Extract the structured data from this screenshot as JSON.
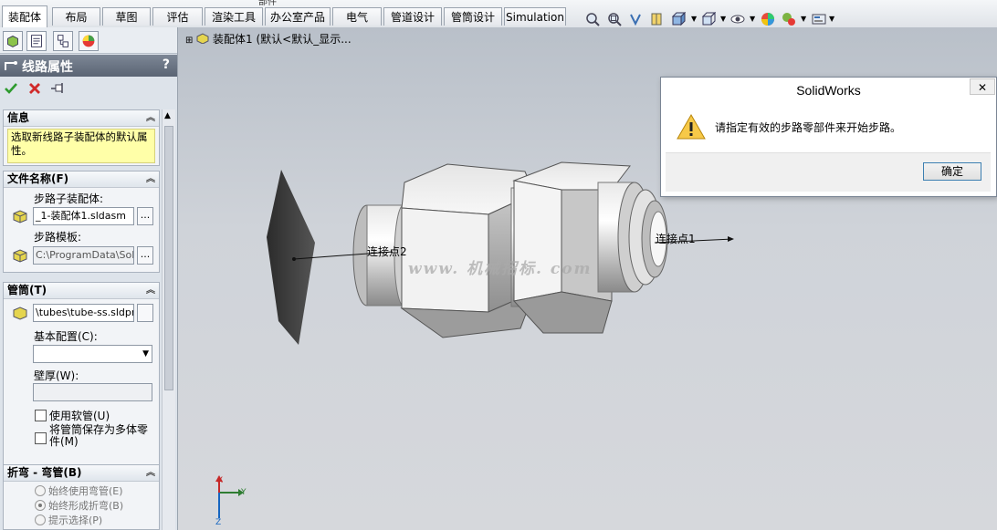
{
  "window": {
    "title_fragment": "部件"
  },
  "tabs": [
    {
      "label": "装配体",
      "active": true
    },
    {
      "label": "布局"
    },
    {
      "label": "草图"
    },
    {
      "label": "评估"
    },
    {
      "label": "渲染工具"
    },
    {
      "label": "办公室产品"
    },
    {
      "label": "电气"
    },
    {
      "label": "管道设计"
    },
    {
      "label": "管筒设计"
    },
    {
      "label": "Simulation"
    }
  ],
  "view_toolbar": {
    "icons": [
      "zoom-to-fit-icon",
      "zoom-area-icon",
      "previous-view-icon",
      "section-view-icon",
      "view-orientation-icon",
      "display-style-icon",
      "hide-show-icon",
      "edit-appearance-icon",
      "apply-scene-icon",
      "view-settings-icon"
    ]
  },
  "property_manager": {
    "title": "线路属性",
    "help": "?",
    "info_group": {
      "title": "信息",
      "text": "选取新线路子装配体的默认属性。"
    },
    "filename_group": {
      "title": "文件名称(F)",
      "sub_assembly_label": "步路子装配体:",
      "sub_assembly_value": "_1-装配体1.sldasm",
      "template_label": "步路模板:",
      "template_value": "C:\\ProgramData\\Solid",
      "browse": "..."
    },
    "tube_group": {
      "title": "管筒(T)",
      "tube_value": "\\tubes\\tube-ss.sldprt",
      "base_config_label": "基本配置(C):",
      "wall_label": "壁厚(W):",
      "use_flex_label": "使用软管(U)",
      "save_multibody_label": "将管筒保存为多体零件(M)"
    },
    "bend_group": {
      "title": "折弯 - 弯管(B)",
      "options": [
        "始终使用弯管(E)",
        "始终形成折弯(B)",
        "提示选择(P)"
      ],
      "selected": 1
    }
  },
  "viewport": {
    "tree_crumb": "装配体1  (默认<默认_显示...",
    "label_cp2": "连接点2",
    "label_cp1": "连接点1",
    "watermark": "www. 机械招标. com",
    "axis_x": "X",
    "axis_y": "Y",
    "axis_z": "Z"
  },
  "dialog": {
    "title": "SolidWorks",
    "close": "✕",
    "message": "请指定有效的步路零部件来开始步路。",
    "ok": "确定"
  }
}
